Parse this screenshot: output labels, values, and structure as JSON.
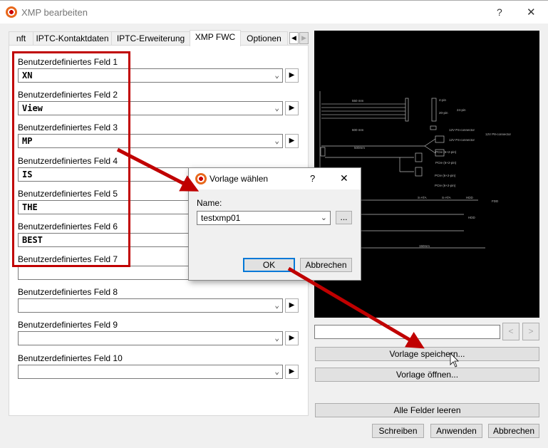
{
  "window": {
    "title": "XMP bearbeiten",
    "help": "?",
    "close": "✕"
  },
  "tabs": [
    {
      "label": "nft"
    },
    {
      "label": "IPTC-Kontaktdaten"
    },
    {
      "label": "IPTC-Erweiterung"
    },
    {
      "label": "XMP FWC"
    },
    {
      "label": "Optionen"
    }
  ],
  "tab_scroll": {
    "left": "◀",
    "right": "▶"
  },
  "fields": [
    {
      "label": "Benutzerdefiniertes Feld 1",
      "value": "XN"
    },
    {
      "label": "Benutzerdefiniertes Feld 2",
      "value": "View"
    },
    {
      "label": "Benutzerdefiniertes Feld 3",
      "value": "MP"
    },
    {
      "label": "Benutzerdefiniertes Feld 4",
      "value": "IS"
    },
    {
      "label": "Benutzerdefiniertes Feld 5",
      "value": "THE"
    },
    {
      "label": "Benutzerdefiniertes Feld 6",
      "value": "BEST"
    },
    {
      "label": "Benutzerdefiniertes Feld 7",
      "value": ""
    },
    {
      "label": "Benutzerdefiniertes Feld 8",
      "value": ""
    },
    {
      "label": "Benutzerdefiniertes Feld 9",
      "value": ""
    },
    {
      "label": "Benutzerdefiniertes Feld 10",
      "value": ""
    }
  ],
  "preview": {
    "labels": [
      "550 mm",
      "4-pin",
      "20-pin",
      "24-pin",
      "600 mm",
      "12V P4-connector",
      "12V P4-connector",
      "12V P8-connector",
      "500mm",
      "PCIe (6+2-pin)",
      "PCIe (6+2-pin)",
      "PCIe (6+2-pin)",
      "PCIe (6+2-pin)",
      "S-ATA",
      "S-ATA",
      "HDD",
      "FDD",
      "HDD",
      "150mm"
    ]
  },
  "nav": {
    "input_value": "",
    "prev": "<",
    "next": ">"
  },
  "buttons": {
    "save_template": "Vorlage speichern...",
    "open_template": "Vorlage öffnen...",
    "clear_all": "Alle Felder leeren",
    "write": "Schreiben",
    "apply": "Anwenden",
    "cancel": "Abbrechen"
  },
  "dialog": {
    "title": "Vorlage wählen",
    "help": "?",
    "close": "✕",
    "name_label": "Name:",
    "name_value": "testxmp01",
    "browse": "...",
    "ok": "OK",
    "cancel": "Abbrechen"
  }
}
